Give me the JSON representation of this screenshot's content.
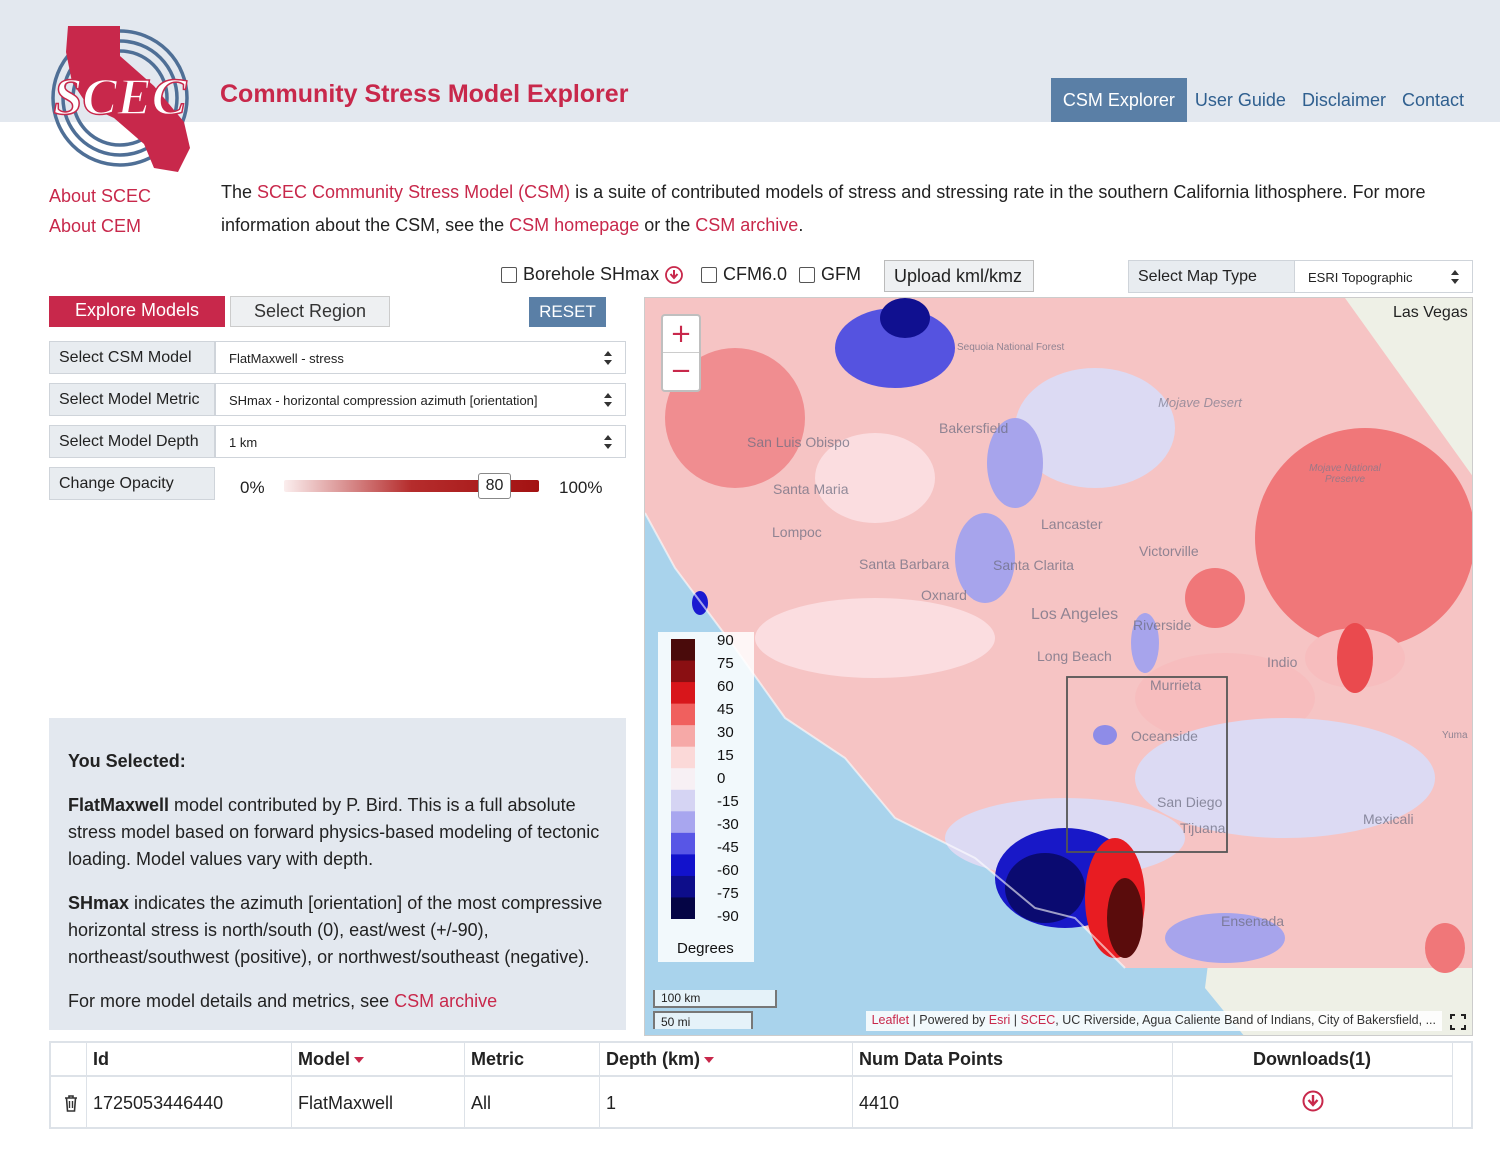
{
  "header": {
    "logo_text": "SCEC",
    "title": "Community Stress Model Explorer",
    "nav": [
      "CSM Explorer",
      "User Guide",
      "Disclaimer",
      "Contact"
    ]
  },
  "sidebar_links": [
    "About SCEC",
    "About CEM"
  ],
  "intro": {
    "t1": "The ",
    "l1": "SCEC Community Stress Model (CSM)",
    "t2": " is a suite of contributed models of stress and stressing rate in the southern California lithosphere. For more information about the CSM, see the ",
    "l2": "CSM homepage",
    "t3": " or the ",
    "l3": "CSM archive",
    "t4": "."
  },
  "layers": {
    "borehole": "Borehole SHmax",
    "cfm": "CFM6.0",
    "gfm": "GFM",
    "upload": "Upload kml/kmz"
  },
  "map_type": {
    "label": "Select Map Type",
    "value": "ESRI Topographic"
  },
  "tabs": {
    "explore": "Explore Models",
    "region": "Select Region",
    "reset": "RESET"
  },
  "controls": {
    "model": {
      "label": "Select CSM Model",
      "value": "FlatMaxwell - stress"
    },
    "metric": {
      "label": "Select Model Metric",
      "value": "SHmax - horizontal compression azimuth [orientation]"
    },
    "depth": {
      "label": "Select Model Depth",
      "value": "1 km"
    },
    "opacity": {
      "label": "Change Opacity",
      "min": "0%",
      "max": "100%",
      "value": "80"
    }
  },
  "selected": {
    "heading": "You Selected:",
    "model_name": "FlatMaxwell",
    "model_desc": " model contributed by P. Bird. This is a full absolute stress model based on forward physics-based modeling of tectonic loading. Model values vary with depth.",
    "metric_name": "SHmax",
    "metric_desc": " indicates the azimuth [orientation] of the most compressive horizontal stress is north/south (0), east/west (+/-90), northeast/southwest (positive), or northwest/southeast (negative).",
    "more": "For more model details and metrics, see ",
    "more_link": "CSM archive"
  },
  "map": {
    "zoom_in": "+",
    "zoom_out": "−",
    "legend": {
      "title": "Degrees",
      "ticks": [
        "90",
        "75",
        "60",
        "45",
        "30",
        "15",
        "0",
        "-15",
        "-30",
        "-45",
        "-60",
        "-75",
        "-90"
      ],
      "colors": [
        "#4a0b0b",
        "#8a0f12",
        "#d8161b",
        "#f0605e",
        "#f6a9a7",
        "#fbd9d8",
        "#f7f0f4",
        "#d5d4f3",
        "#a8a6ef",
        "#5856e6",
        "#1212cc",
        "#0d0d8a",
        "#050545"
      ]
    },
    "scale_km": "100 km",
    "scale_mi": "50 mi",
    "attribution": {
      "leaflet": "Leaflet",
      "sep1": " | Powered by ",
      "esri": "Esri",
      "sep2": " | ",
      "scec": "SCEC",
      "rest": ", UC Riverside, Agua Caliente Band of Indians, City of Bakersfield, ..."
    },
    "cities": {
      "las_vegas": "Las Vegas",
      "sequoia": "Sequoia National Forest",
      "mojave": "Mojave Desert",
      "mojave_preserve": "Mojave National Preserve",
      "bakersfield": "Bakersfield",
      "san_luis_obispo": "San Luis Obispo",
      "santa_maria": "Santa Maria",
      "lompoc": "Lompoc",
      "lancaster": "Lancaster",
      "victorville": "Victorville",
      "santa_barbara": "Santa Barbara",
      "santa_clarita": "Santa Clarita",
      "oxnard": "Oxnard",
      "los_angeles": "Los Angeles",
      "riverside": "Riverside",
      "long_beach": "Long Beach",
      "indio": "Indio",
      "murrieta": "Murrieta",
      "oceanside": "Oceanside",
      "san_diego": "San Diego",
      "tijuana": "Tijuana",
      "mexicali": "Mexicali",
      "ensenada": "Ensenada",
      "yuma": "Yuma"
    }
  },
  "table": {
    "headers": [
      "Id",
      "Model",
      "Metric",
      "Depth (km)",
      "Num Data Points",
      "Downloads(1)"
    ],
    "row": [
      "1725053446440",
      "FlatMaxwell",
      "All",
      "1",
      "4410"
    ]
  },
  "colors": {
    "accent": "#c8284b",
    "nav_active": "#5a7fa6",
    "band": "#e3e8ef"
  }
}
